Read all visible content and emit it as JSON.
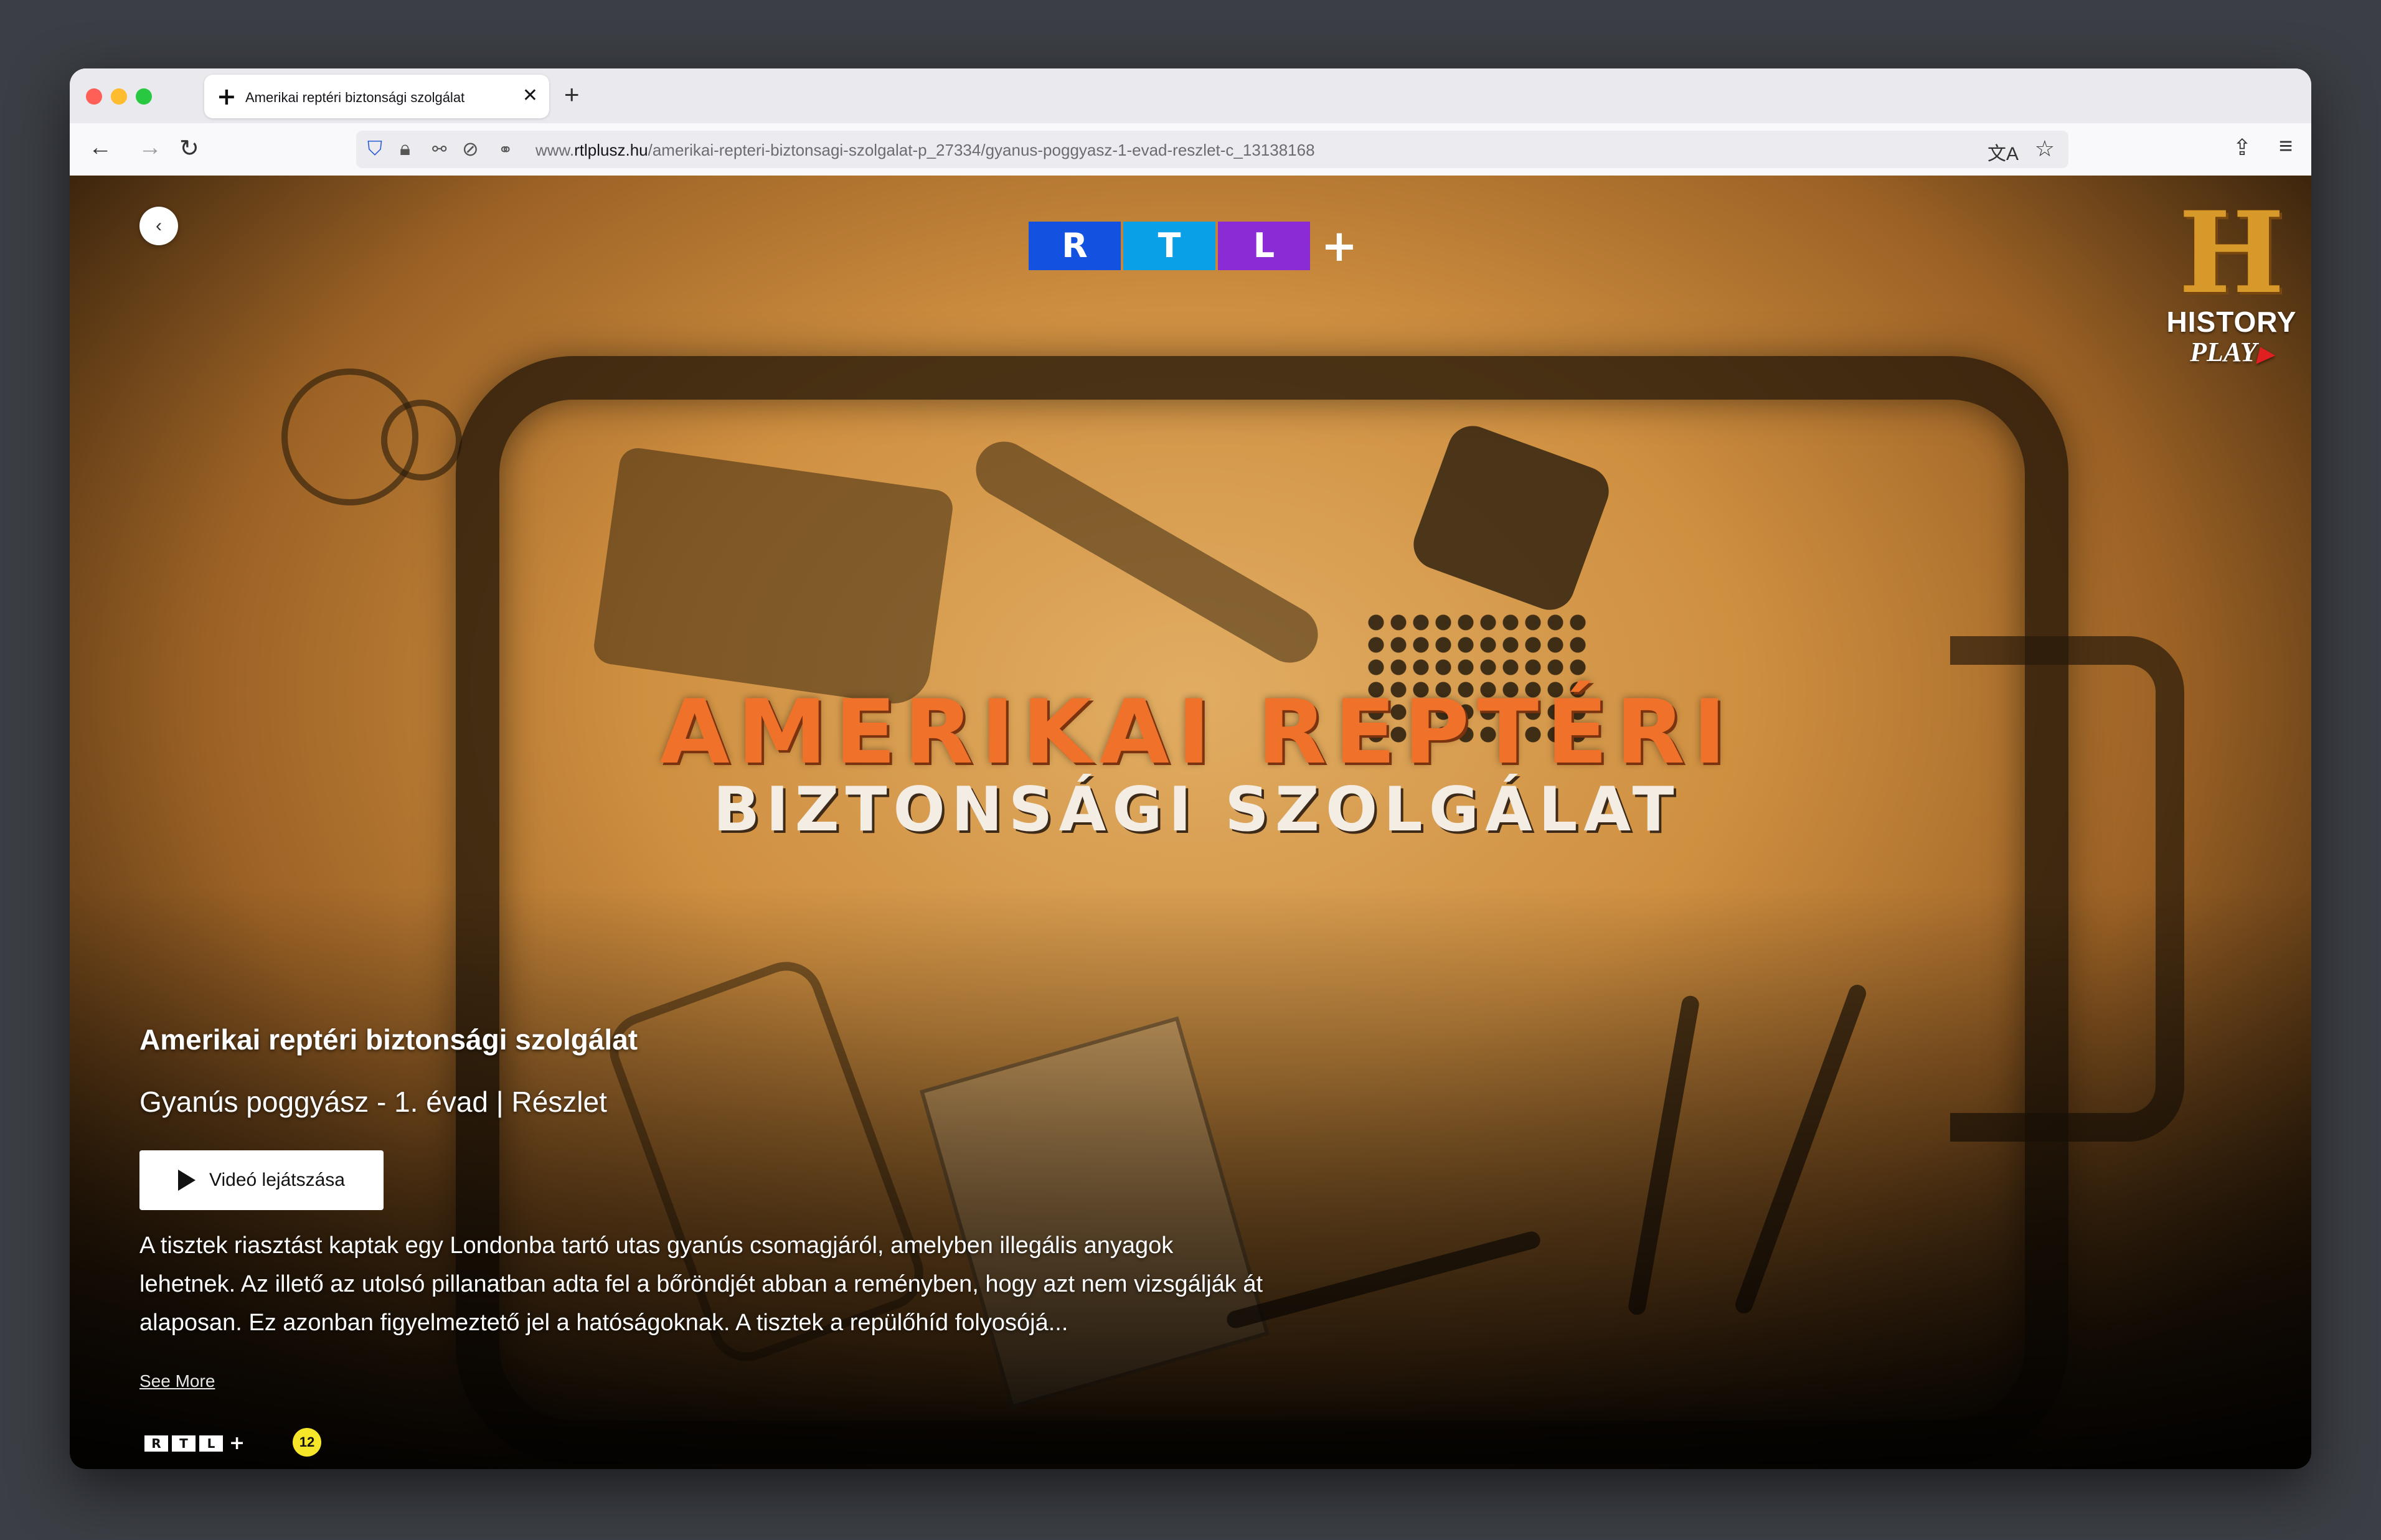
{
  "browser": {
    "tab_title": "Amerikai reptéri biztonsági szolgálat",
    "tab_favicon": "plus-icon",
    "url_prefix": "www.",
    "url_domain": "rtlplusz.hu",
    "url_path": "/amerikai-repteri-biztonsagi-szolgalat-p_27334/gyanus-poggyasz-1-evad-reszlet-c_13138168"
  },
  "hero": {
    "logo_letters": [
      "R",
      "T",
      "L"
    ],
    "logo_plus": "+",
    "logo_colors": [
      "#1352e0",
      "#0aa0e8",
      "#8a2bd6"
    ],
    "channel_logo_text": "HISTORY",
    "channel_logo_sub": "PLAY",
    "show_title_line1": "AMERIKAI REPTÉRI",
    "show_title_line2": "BIZTONSÁGI SZOLGÁLAT",
    "accent_color": "#f0722a"
  },
  "info": {
    "title": "Amerikai reptéri biztonsági szolgálat",
    "subtitle": "Gyanús poggyász - 1. évad | Részlet",
    "play_label": "Videó lejátszása",
    "description": "A tisztek riasztást kaptak egy Londonba tartó utas gyanús csomagjáról, amelyben illegális anyagok lehetnek. Az illető az utolsó pillanatban adta fel a bőröndjét abban a reményben, hogy azt nem vizsgálják át alaposan. Ez azonban figyelmeztető jel a hatóságoknak. A tisztek a repülőhíd folyosójá...",
    "see_more": "See More",
    "age_rating": "12"
  }
}
